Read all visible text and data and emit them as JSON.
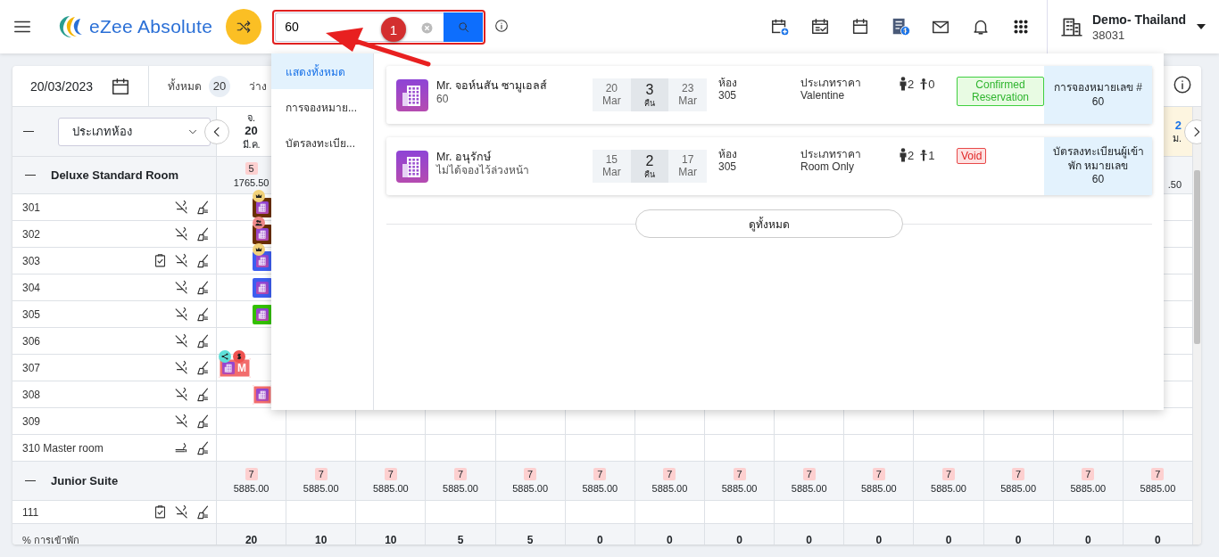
{
  "header": {
    "logo": "eZee Absolute",
    "search": {
      "value": "60"
    },
    "annotation": {
      "badge": "1"
    },
    "property": {
      "name": "Demo- Thailand",
      "code": "38031"
    }
  },
  "toolbar": {
    "date": "20/03/2023",
    "stats": [
      {
        "label": "ทั้งหมด",
        "count": "20"
      },
      {
        "label": "ว่าง"
      }
    ]
  },
  "grid": {
    "room_type_select": "ประเภทห้อง",
    "columns": [
      {
        "weekday": "จ.",
        "day": "20",
        "month": "มี.ค."
      }
    ],
    "column_tail": {
      "day": "2",
      "month": "ม.",
      "highlighted": true
    },
    "groups": [
      {
        "name": "Deluxe Standard Room",
        "expanded": true,
        "rates": [
          {
            "count": "5",
            "rate": "1765.50"
          }
        ],
        "rate_tail": ".50",
        "rooms": [
          {
            "name": "301",
            "smoking": false,
            "inspected": false,
            "booking": {
              "kind": "solid",
              "color": "#6b3000",
              "from_start": false,
              "badges": [
                {
                  "kind": "crown"
                }
              ]
            }
          },
          {
            "name": "302",
            "smoking": false,
            "inspected": false,
            "booking": {
              "kind": "solid",
              "color": "#6b3000",
              "from_start": false,
              "badges": [
                {
                  "kind": "guests"
                }
              ]
            }
          },
          {
            "name": "303",
            "smoking": false,
            "inspected": true,
            "booking": {
              "kind": "solid",
              "color": "#3d5ef0",
              "from_start": false,
              "badges": [
                {
                  "kind": "crown"
                }
              ]
            }
          },
          {
            "name": "304",
            "smoking": false,
            "inspected": false,
            "booking": {
              "kind": "solid",
              "color": "#3d5ef0",
              "from_start": false
            }
          },
          {
            "name": "305",
            "smoking": false,
            "inspected": false,
            "booking": {
              "kind": "solid",
              "color": "#33c000",
              "from_start": false
            }
          },
          {
            "name": "306",
            "smoking": false,
            "inspected": false
          },
          {
            "name": "307",
            "smoking": false,
            "inspected": false,
            "booking": {
              "kind": "outlined",
              "color": "#f26d6d",
              "from_start": true,
              "label": "M",
              "badges": [
                {
                  "kind": "share"
                },
                {
                  "kind": "dollar"
                }
              ]
            }
          },
          {
            "name": "308",
            "smoking": false,
            "inspected": false,
            "booking": {
              "kind": "outlined",
              "color": "#f26d6d",
              "from_start": false
            }
          },
          {
            "name": "309",
            "smoking": false,
            "inspected": false
          },
          {
            "name": "310 Master room",
            "smoking": true,
            "inspected": false
          }
        ]
      },
      {
        "name": "Junior Suite",
        "expanded": true,
        "rates": [
          {
            "count": "7",
            "rate": "5885.00"
          },
          {
            "count": "7",
            "rate": "5885.00"
          },
          {
            "count": "7",
            "rate": "5885.00"
          },
          {
            "count": "7",
            "rate": "5885.00"
          },
          {
            "count": "7",
            "rate": "5885.00"
          },
          {
            "count": "7",
            "rate": "5885.00"
          },
          {
            "count": "7",
            "rate": "5885.00"
          },
          {
            "count": "7",
            "rate": "5885.00"
          },
          {
            "count": "7",
            "rate": "5885.00"
          },
          {
            "count": "7",
            "rate": "5885.00"
          },
          {
            "count": "7",
            "rate": "5885.00"
          },
          {
            "count": "7",
            "rate": "5885.00"
          },
          {
            "count": "7",
            "rate": "5885.00"
          },
          {
            "count": "7",
            "rate": "5885.00"
          }
        ],
        "rooms": [
          {
            "name": "111",
            "smoking": false,
            "inspected": true
          }
        ]
      }
    ],
    "occupancy": {
      "label": "% การเข้าพัก",
      "values": [
        "20",
        "10",
        "10",
        "5",
        "5",
        "0",
        "0",
        "0",
        "0",
        "0",
        "0",
        "0",
        "0",
        "0"
      ]
    }
  },
  "search_results": {
    "sections": [
      {
        "label": "แสดงทั้งหมด",
        "selected": true
      },
      {
        "label": "การจองหมาย...",
        "selected": false
      },
      {
        "label": "บัตรลงทะเบีย...",
        "selected": false
      }
    ],
    "results": [
      {
        "name": "Mr. จอห์นสัน ซามูเอลส์",
        "sub": "60",
        "check_in": {
          "day": "20",
          "month": "Mar"
        },
        "nights": {
          "count": "3",
          "label": "คืน"
        },
        "check_out": {
          "day": "23",
          "month": "Mar"
        },
        "room_label": "ห้อง",
        "room": "305",
        "rate_label": "ประเภทราคา",
        "rate": "Valentine",
        "adults": "2",
        "children": "0",
        "status": {
          "kind": "confirmed",
          "text": "Confirmed Reservation"
        },
        "ref_label": "การจองหมายเลข #",
        "ref_number": "60"
      },
      {
        "name": "Mr. อนุรักษ์",
        "sub": "ไม่ได้จองไว้ล่วงหน้า",
        "check_in": {
          "day": "15",
          "month": "Mar"
        },
        "nights": {
          "count": "2",
          "label": "คืน"
        },
        "check_out": {
          "day": "17",
          "month": "Mar"
        },
        "room_label": "ห้อง",
        "room": "305",
        "rate_label": "ประเภทราคา",
        "rate": "Room Only",
        "adults": "2",
        "children": "1",
        "status": {
          "kind": "void",
          "text": "Void"
        },
        "ref_label": "บัตรลงทะเบียนผู้เข้าพัก หมายเลข",
        "ref_number": "60"
      }
    ],
    "view_all": "ดูทั้งหมด"
  }
}
